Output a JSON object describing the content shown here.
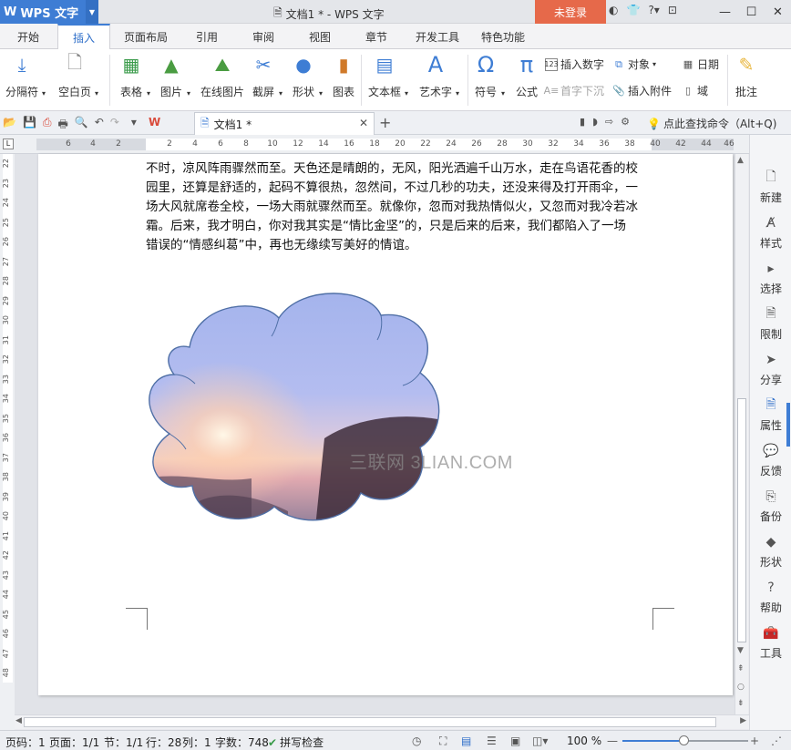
{
  "titlebar": {
    "app_logo": "W",
    "app_name": "WPS 文字",
    "doc_title": "文档1 * - WPS 文字",
    "login": "未登录",
    "icons": [
      "skin-icon",
      "shirt-icon",
      "help-icon",
      "collapse-ribbon-icon"
    ]
  },
  "menu": {
    "tabs": [
      "开始",
      "插入",
      "页面布局",
      "引用",
      "审阅",
      "视图",
      "章节",
      "开发工具",
      "特色功能"
    ],
    "active": "插入"
  },
  "ribbon": {
    "page_break": "分隔符",
    "blank_page": "空白页",
    "table": "表格",
    "picture": "图片",
    "online_picture": "在线图片",
    "screenshot": "截屏",
    "shapes": "形状",
    "chart": "图表",
    "textbox": "文本框",
    "wordart": "艺术字",
    "symbol": "符号",
    "formula": "公式",
    "insert_number": "插入数字",
    "dropcap": "首字下沉",
    "object": "对象",
    "attachment": "插入附件",
    "date": "日期",
    "field": "域",
    "comment": "批注"
  },
  "quickbar": {
    "doc_tab": "文档1 *",
    "find_command": "点此查找命令（Alt+Q)"
  },
  "ruler": {
    "h_ticks": [
      "6",
      "4",
      "2",
      "2",
      "4",
      "6",
      "8",
      "10",
      "12",
      "14",
      "16",
      "18",
      "20",
      "22",
      "24",
      "26",
      "28",
      "30",
      "32",
      "34",
      "36",
      "38",
      "40",
      "42",
      "44",
      "46"
    ],
    "v_ticks": [
      "22",
      "23",
      "24",
      "25",
      "26",
      "27",
      "28",
      "29",
      "30",
      "31",
      "32",
      "33",
      "34",
      "35",
      "36",
      "37",
      "38",
      "39",
      "40",
      "41",
      "42",
      "43",
      "44",
      "45",
      "46",
      "47",
      "48"
    ]
  },
  "document": {
    "paragraph": [
      "不时，凉风阵雨骤然而至。天色还是晴朗的，无风，阳光洒遍千山万水，走在鸟语花香的校",
      "园里，还算是舒适的，起码不算很热，忽然间，不过几秒的功夫，还没来得及打开雨伞，一",
      "场大风就席卷全校，一场大雨就骤然而至。就像你，忽而对我热情似火，又忽而对我冷若冰",
      "霜。后来，我才明白，你对我其实是“情比金坚”的，只是后来的后来，我们都陷入了一场",
      "错误的“情感纠葛”中，再也无缘续写美好的情谊。"
    ],
    "watermark": "三联网 3LIAN.COM"
  },
  "rightpanel": [
    {
      "label": "新建",
      "icon": "new-doc-icon"
    },
    {
      "label": "样式",
      "icon": "style-icon"
    },
    {
      "label": "选择",
      "icon": "select-icon"
    },
    {
      "label": "限制",
      "icon": "restrict-icon"
    },
    {
      "label": "分享",
      "icon": "share-icon"
    },
    {
      "label": "属性",
      "icon": "properties-icon"
    },
    {
      "label": "反馈",
      "icon": "feedback-icon"
    },
    {
      "label": "备份",
      "icon": "backup-icon"
    },
    {
      "label": "形状",
      "icon": "shape-icon"
    },
    {
      "label": "帮助",
      "icon": "help-icon"
    },
    {
      "label": "工具",
      "icon": "toolbox-icon"
    }
  ],
  "status": {
    "page_number": "页码：1",
    "pages": "页面：1/1",
    "section": "节：1/1",
    "line": "行：28",
    "column": "列：1",
    "word_count": "字数：748",
    "spellcheck": "拼写检查",
    "zoom": "100 %"
  },
  "colors": {
    "accent": "#3e7dd4",
    "login": "#e6694a"
  }
}
